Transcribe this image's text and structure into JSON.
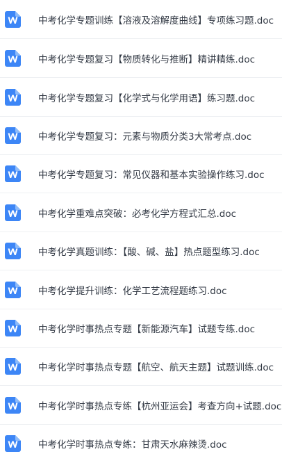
{
  "icon": {
    "name": "word-doc-icon",
    "letter": "W",
    "color": "#3d86f6"
  },
  "files": [
    {
      "name": "中考化学专题训练【溶液及溶解度曲线】专项练习题.doc"
    },
    {
      "name": "中考化学专题复习【物质转化与推断】精讲精练.doc"
    },
    {
      "name": "中考化学专题复习【化学式与化学用语】练习题.doc"
    },
    {
      "name": "中考化学专题复习：元素与物质分类3大常考点.doc"
    },
    {
      "name": "中考化学专题复习：常见仪器和基本实验操作练习.doc"
    },
    {
      "name": "中考化学重难点突破：必考化学方程式汇总.doc"
    },
    {
      "name": "中考化学真题训练：【酸、碱、盐】热点题型练习.doc"
    },
    {
      "name": "中考化学提升训练：化学工艺流程题练习.doc"
    },
    {
      "name": "中考化学时事热点专题【新能源汽车】试题专练.doc"
    },
    {
      "name": "中考化学时事热点专题【航空、航天主题】试题训练.doc"
    },
    {
      "name": "中考化学时事热点专练【杭州亚运会】考查方向+试题.doc"
    },
    {
      "name": "中考化学时事热点专练：甘肃天水麻辣烫.doc"
    }
  ]
}
